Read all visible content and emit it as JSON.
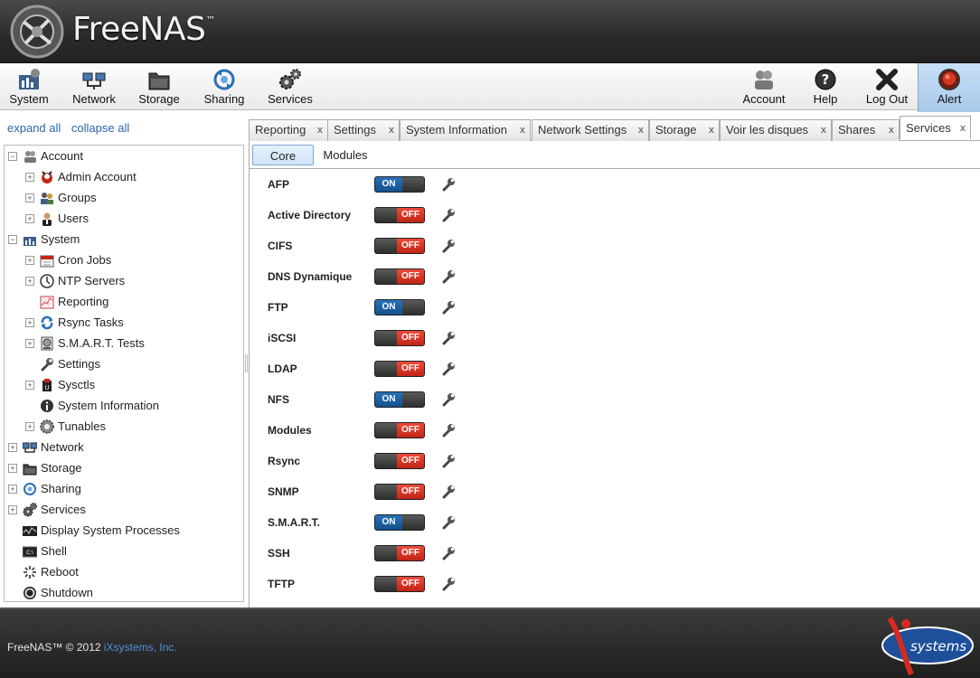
{
  "brand": {
    "name": "FreeNAS",
    "tm": "™"
  },
  "toolbar": {
    "left": [
      {
        "label": "System",
        "icon": "system-icon"
      },
      {
        "label": "Network",
        "icon": "network-icon"
      },
      {
        "label": "Storage",
        "icon": "storage-icon"
      },
      {
        "label": "Sharing",
        "icon": "sharing-icon"
      },
      {
        "label": "Services",
        "icon": "services-icon"
      }
    ],
    "right": [
      {
        "label": "Account",
        "icon": "account-icon"
      },
      {
        "label": "Help",
        "icon": "help-icon"
      },
      {
        "label": "Log Out",
        "icon": "logout-icon"
      },
      {
        "label": "Alert",
        "icon": "alert-icon"
      }
    ]
  },
  "sidebar": {
    "expand_all": "expand all",
    "collapse_all": "collapse all",
    "tree": [
      {
        "label": "Account",
        "level": 0,
        "toggle": "−",
        "icon": "account-icon"
      },
      {
        "label": "Admin Account",
        "level": 1,
        "toggle": "+",
        "icon": "admin-account-icon"
      },
      {
        "label": "Groups",
        "level": 1,
        "toggle": "+",
        "icon": "groups-icon"
      },
      {
        "label": "Users",
        "level": 1,
        "toggle": "+",
        "icon": "users-icon"
      },
      {
        "label": "System",
        "level": 0,
        "toggle": "−",
        "icon": "system-icon"
      },
      {
        "label": "Cron Jobs",
        "level": 1,
        "toggle": "+",
        "icon": "calendar-icon"
      },
      {
        "label": "NTP Servers",
        "level": 1,
        "toggle": "+",
        "icon": "clock-icon"
      },
      {
        "label": "Reporting",
        "level": 1,
        "toggle": "",
        "icon": "chart-icon"
      },
      {
        "label": "Rsync Tasks",
        "level": 1,
        "toggle": "+",
        "icon": "sync-icon"
      },
      {
        "label": "S.M.A.R.T. Tests",
        "level": 1,
        "toggle": "+",
        "icon": "disk-test-icon"
      },
      {
        "label": "Settings",
        "level": 1,
        "toggle": "",
        "icon": "wrench-icon"
      },
      {
        "label": "Sysctls",
        "level": 1,
        "toggle": "+",
        "icon": "sysctl-icon"
      },
      {
        "label": "System Information",
        "level": 1,
        "toggle": "",
        "icon": "info-icon"
      },
      {
        "label": "Tunables",
        "level": 1,
        "toggle": "+",
        "icon": "tunables-icon"
      },
      {
        "label": "Network",
        "level": 0,
        "toggle": "+",
        "icon": "network-icon"
      },
      {
        "label": "Storage",
        "level": 0,
        "toggle": "+",
        "icon": "storage-icon"
      },
      {
        "label": "Sharing",
        "level": 0,
        "toggle": "+",
        "icon": "sharing-icon"
      },
      {
        "label": "Services",
        "level": 0,
        "toggle": "+",
        "icon": "services-icon"
      },
      {
        "label": "Display System Processes",
        "level": 0,
        "toggle": "",
        "icon": "processes-icon"
      },
      {
        "label": "Shell",
        "level": 0,
        "toggle": "",
        "icon": "shell-icon"
      },
      {
        "label": "Reboot",
        "level": 0,
        "toggle": "",
        "icon": "reboot-icon"
      },
      {
        "label": "Shutdown",
        "level": 0,
        "toggle": "",
        "icon": "shutdown-icon"
      }
    ]
  },
  "tabs": [
    {
      "label": "Reporting",
      "active": false
    },
    {
      "label": "Settings",
      "active": false
    },
    {
      "label": "System Information",
      "active": false
    },
    {
      "label": "Network Settings",
      "active": false
    },
    {
      "label": "Storage",
      "active": false
    },
    {
      "label": "Voir les disques",
      "active": false
    },
    {
      "label": "Shares",
      "active": false
    },
    {
      "label": "Services",
      "active": true
    }
  ],
  "tab_close": "x",
  "subtabs": [
    {
      "label": "Core",
      "active": true
    },
    {
      "label": "Modules",
      "active": false
    }
  ],
  "services": [
    {
      "name": "AFP",
      "state": "ON"
    },
    {
      "name": "Active Directory",
      "state": "OFF"
    },
    {
      "name": "CIFS",
      "state": "OFF"
    },
    {
      "name": "DNS Dynamique",
      "state": "OFF"
    },
    {
      "name": "FTP",
      "state": "ON"
    },
    {
      "name": "iSCSI",
      "state": "OFF"
    },
    {
      "name": "LDAP",
      "state": "OFF"
    },
    {
      "name": "NFS",
      "state": "ON"
    },
    {
      "name": "Modules",
      "state": "OFF"
    },
    {
      "name": "Rsync",
      "state": "OFF"
    },
    {
      "name": "SNMP",
      "state": "OFF"
    },
    {
      "name": "S.M.A.R.T.",
      "state": "ON"
    },
    {
      "name": "SSH",
      "state": "OFF"
    },
    {
      "name": "TFTP",
      "state": "OFF"
    }
  ],
  "footer": {
    "copyright": "FreeNAS™ © 2012 ",
    "company": "iXsystems, Inc.",
    "logo_text": "iXsystems"
  },
  "colors": {
    "on": "#1a5fa0",
    "off": "#d9301f",
    "link": "#2a66b0",
    "footer_link": "#4f8fd8"
  }
}
